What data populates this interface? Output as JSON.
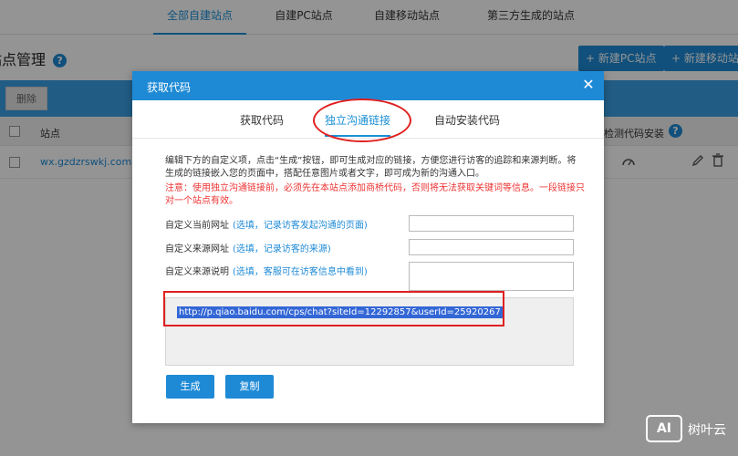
{
  "top_tabs": [
    {
      "label": "全部自建站点",
      "active": true
    },
    {
      "label": "自建PC站点",
      "active": false
    },
    {
      "label": "自建移动站点",
      "active": false
    },
    {
      "label": "第三方生成的站点",
      "active": false
    }
  ],
  "page": {
    "title": "站点管理",
    "help_icon": "?",
    "new_pc_button": "+ 新建PC站点",
    "new_mobile_button": "+ 新建移动站点"
  },
  "toolbar": {
    "delete_label": "删除"
  },
  "table": {
    "col_site": "站点",
    "col_detect": "检测代码安装",
    "rows": [
      {
        "site": "wx.gzdzrswkj.com"
      }
    ]
  },
  "dialog": {
    "title": "获取代码",
    "close_icon": "✕",
    "tabs": [
      {
        "label": "获取代码",
        "active": false
      },
      {
        "label": "独立沟通链接",
        "active": true
      },
      {
        "label": "自动安装代码",
        "active": false
      }
    ],
    "description": "编辑下方的自定义项，点击“生成”按钮，即可生成对应的链接，方便您进行访客的追踪和来源判断。将生成的链接嵌入您的页面中，搭配任意图片或者文字，即可成为新的沟通入口。",
    "warning": "注意：使用独立沟通链接前，必须先在本站点添加商桥代码，否则将无法获取关键词等信息。一段链接只对一个站点有效。",
    "fields": [
      {
        "label": "自定义当前网址",
        "hint": "(选填，记录访客发起沟通的页面)"
      },
      {
        "label": "自定义来源网址",
        "hint": "(选填，记录访客的来源)"
      },
      {
        "label": "自定义来源说明",
        "hint": "(选填，客服可在访客信息中看到)"
      }
    ],
    "result_link": "http://p.qiao.baidu.com/cps/chat?siteId=12292857&userId=25920267",
    "generate_button": "生成",
    "copy_button": "复制"
  },
  "watermark": {
    "logo": "AI",
    "text": "树叶云"
  },
  "colors": {
    "accent": "#1e8ad6",
    "annotation": "#e02020",
    "warning": "#e33333"
  }
}
